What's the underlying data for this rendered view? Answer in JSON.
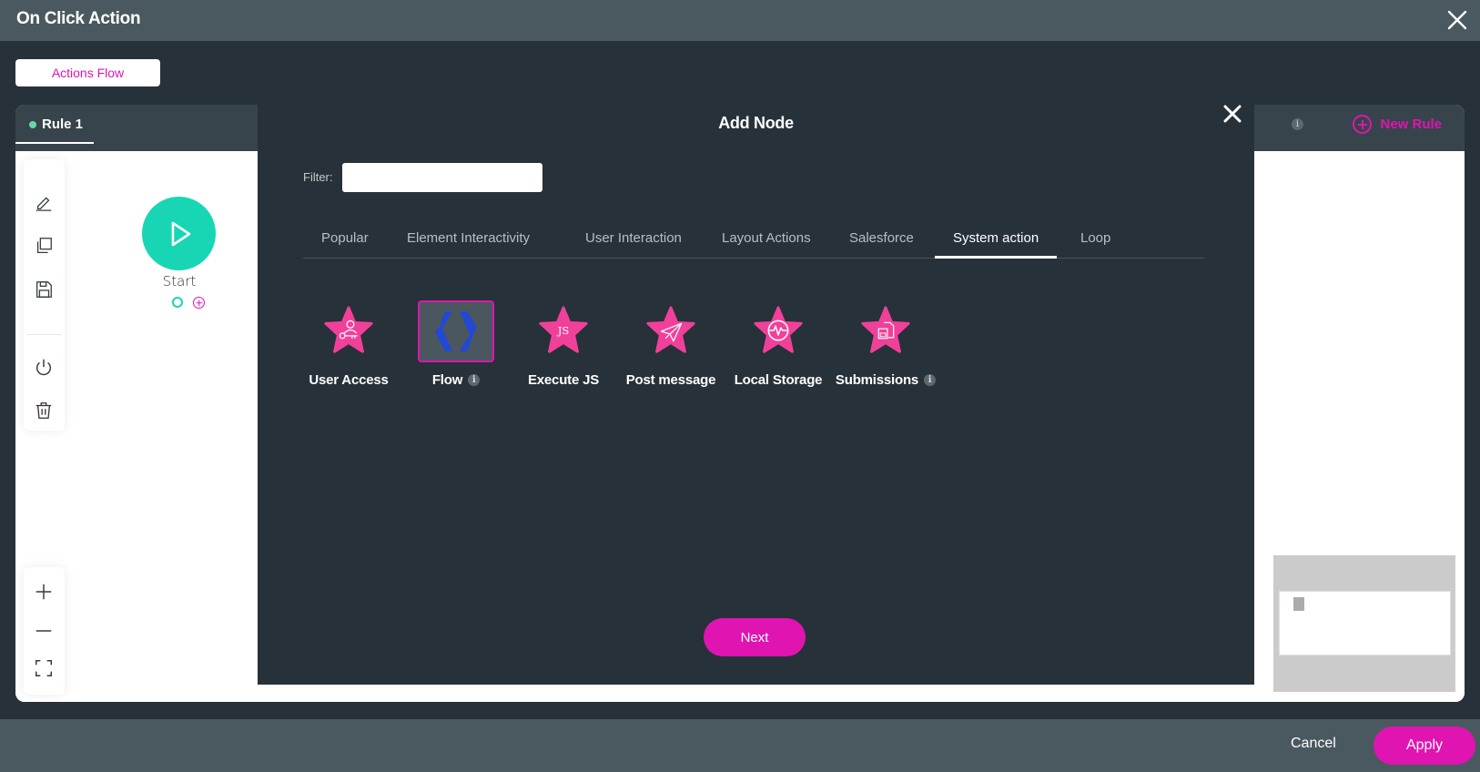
{
  "window": {
    "title": "On Click Action",
    "close_icon": "close-icon"
  },
  "actions_flow_button": "Actions Flow",
  "rules": {
    "tabs": [
      {
        "label": "Rule 1",
        "status_color": "#6dd3a8",
        "active": true
      }
    ],
    "info_icon": "i",
    "new_rule_label": "New Rule"
  },
  "canvas": {
    "toolbar": [
      "edit-icon",
      "copy-icon",
      "save-icon",
      "power-icon",
      "delete-icon"
    ],
    "zoom_controls": [
      "zoom-in-icon",
      "zoom-out-icon",
      "fit-screen-icon"
    ],
    "start_node": {
      "label": "Start",
      "color": "#18d6b4"
    }
  },
  "modal": {
    "title": "Add Node",
    "filter_label": "Filter:",
    "filter_value": "",
    "tabs": [
      {
        "label": "Popular",
        "active": false
      },
      {
        "label": "Element Interactivity",
        "active": false
      },
      {
        "label": "User Interaction",
        "active": false
      },
      {
        "label": "Layout Actions",
        "active": false
      },
      {
        "label": "Salesforce",
        "active": false
      },
      {
        "label": "System action",
        "active": true
      },
      {
        "label": "Loop",
        "active": false
      }
    ],
    "nodes": [
      {
        "label": "User Access",
        "icon": "user-key-icon",
        "info": false,
        "selected": false
      },
      {
        "label": "Flow",
        "icon": "flow-brackets-icon",
        "info": true,
        "selected": true
      },
      {
        "label": "Execute JS",
        "icon": "js-icon",
        "icon_text": "JS",
        "info": false,
        "selected": false
      },
      {
        "label": "Post message",
        "icon": "paper-plane-icon",
        "info": false,
        "selected": false
      },
      {
        "label": "Local Storage",
        "icon": "pulse-icon",
        "info": false,
        "selected": false
      },
      {
        "label": "Submissions",
        "icon": "document-save-icon",
        "info": true,
        "selected": false
      }
    ],
    "info_glyph": "i",
    "next_label": "Next"
  },
  "footer": {
    "cancel_label": "Cancel",
    "apply_label": "Apply"
  },
  "colors": {
    "accent": "#e014b0",
    "star": "#f1409a",
    "flow_icon": "#2148d6",
    "start": "#18d6b4"
  }
}
